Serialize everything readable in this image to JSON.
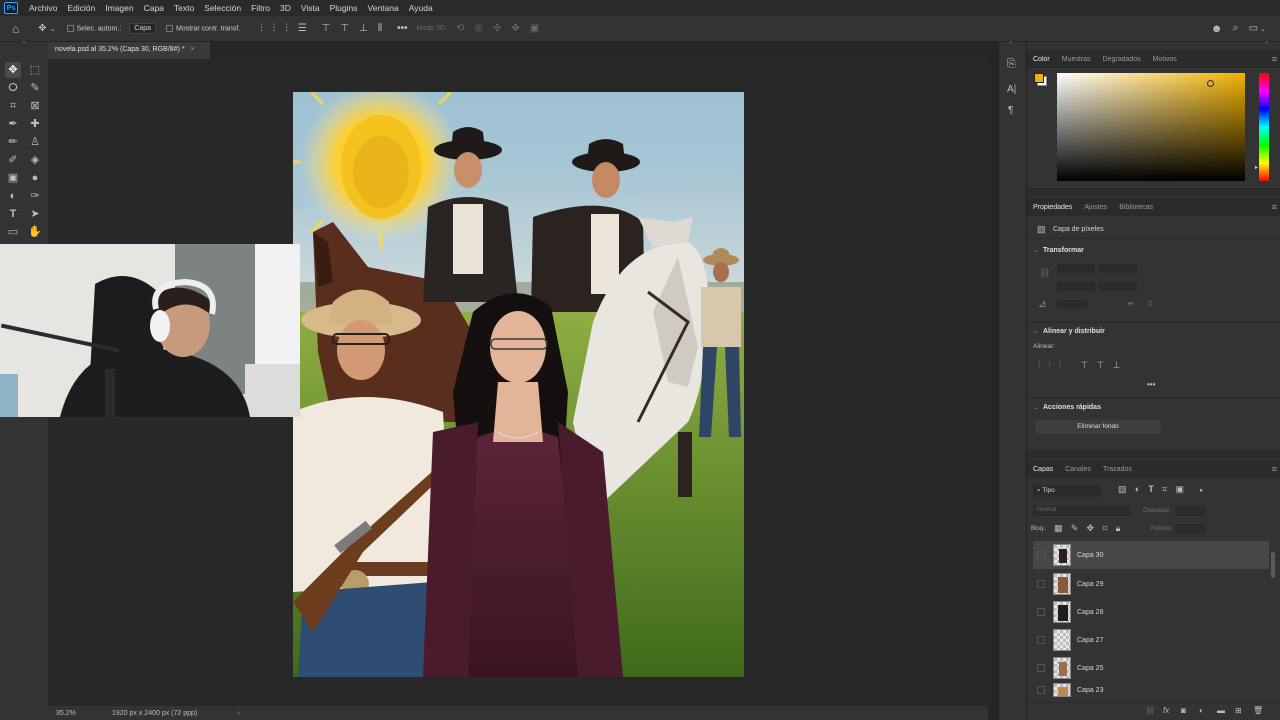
{
  "menubar": {
    "logo": "Ps",
    "items": [
      "Archivo",
      "Edición",
      "Imagen",
      "Capa",
      "Texto",
      "Selección",
      "Filtro",
      "3D",
      "Vista",
      "Plugins",
      "Ventana",
      "Ayuda"
    ]
  },
  "options": {
    "auto_select": "Selec. autom.:",
    "auto_select_value": "Capa",
    "show_transform": "Mostrar contr. transf.",
    "mode3d": "Modo 3D:"
  },
  "document": {
    "tab_title": "novela.psd al 35.2% (Capa 30, RGB/8#) *",
    "zoom": "35.2%",
    "info": "1920 px x 2400 px (72 ppp)"
  },
  "color_panel": {
    "tabs": [
      "Color",
      "Muestras",
      "Degradados",
      "Motivos"
    ],
    "foreground": "#f2b200",
    "background": "#ffffff"
  },
  "properties": {
    "tabs": [
      "Propiedades",
      "Ajustes",
      "Bibliotecas"
    ],
    "layer_type": "Capa de píxeles",
    "transform_title": "Transformar",
    "align_title": "Alinear y distribuir",
    "align_label": "Alinear:",
    "quick_title": "Acciones rápidas",
    "remove_bg": "Eliminar fondo"
  },
  "layers": {
    "tabs": [
      "Capas",
      "Canales",
      "Trazados"
    ],
    "filter": "Tipo",
    "blend": "Normal",
    "opacity_label": "Opacidad:",
    "lock_label": "Bloq.:",
    "fill_label": "Relleno:",
    "items": [
      {
        "name": "Capa 30",
        "selected": true
      },
      {
        "name": "Capa 29",
        "selected": false
      },
      {
        "name": "Capa 28",
        "selected": false
      },
      {
        "name": "Capa 27",
        "selected": false
      },
      {
        "name": "Capa 25",
        "selected": false
      },
      {
        "name": "Capa 23",
        "selected": false
      }
    ]
  }
}
